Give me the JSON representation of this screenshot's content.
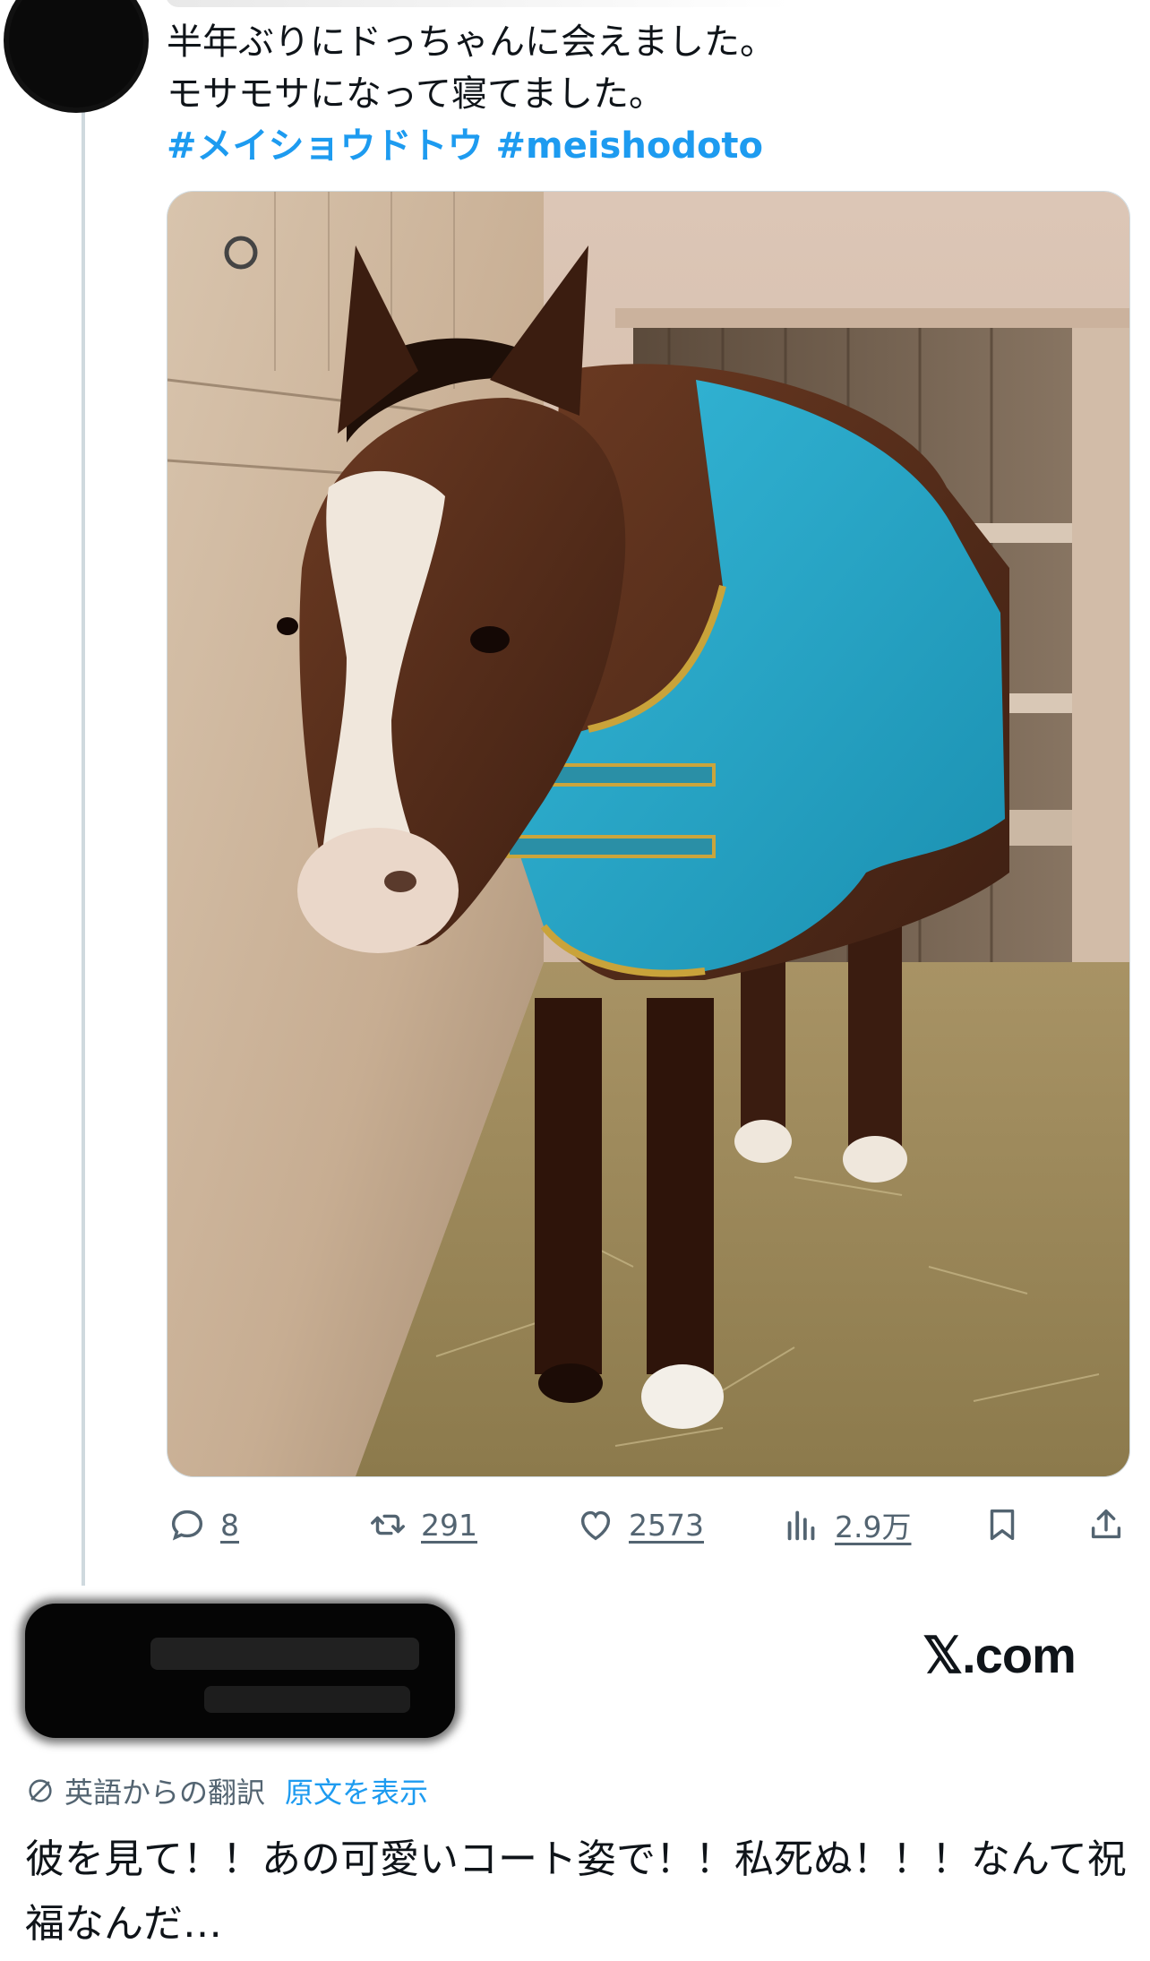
{
  "tweet": {
    "text_line1": "半年ぶりにドっちゃんに会えました。",
    "text_line2": "モサモサになって寝てました。",
    "hashtags": [
      "#メイショウドトウ",
      "#meishodoto"
    ]
  },
  "actions": {
    "replies": "8",
    "retweets": "291",
    "likes": "2573",
    "views": "2.9万"
  },
  "reply": {
    "brand": "𝕏.com",
    "translate_label": "英語からの翻訳",
    "show_original": "原文を表示",
    "text": "彼を見て！！あの可愛いコート姿で！！私死ぬ！！！なんて祝福なんだ…"
  },
  "colors": {
    "accent": "#1d9bf0",
    "muted": "#536471",
    "text": "#0f1419",
    "blanket": "#1fa3c4"
  },
  "icons": [
    "reply-icon",
    "retweet-icon",
    "like-icon",
    "views-icon",
    "bookmark-icon",
    "share-icon",
    "translate-icon"
  ]
}
